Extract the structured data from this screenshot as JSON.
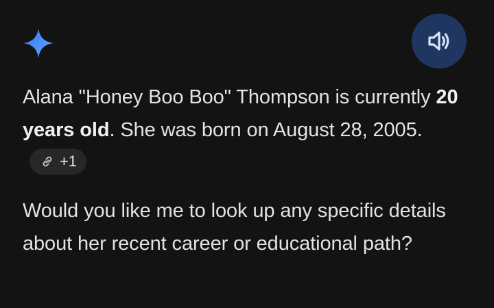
{
  "header": {
    "assistant_icon": "gemini-sparkle-icon",
    "speaker_icon": "volume-icon",
    "accent_color": "#4a8cf7",
    "speaker_button_color": "#1f3760"
  },
  "response": {
    "p1_before_bold": "Alana \"Honey Boo Boo\" Thompson is currently ",
    "p1_bold": "20 years old",
    "p1_after_bold": ". She was born on August 28, 2005.",
    "source_chip": {
      "icon": "link-icon",
      "count_label": "+1"
    },
    "p2": "Would you like me to look up any specific details about her recent career or educational path?"
  }
}
